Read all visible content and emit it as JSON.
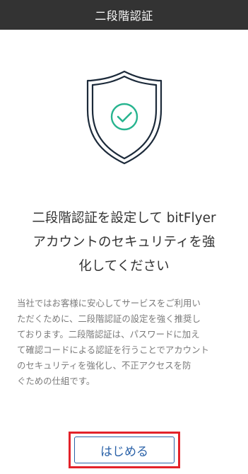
{
  "header": {
    "title": "二段階認証"
  },
  "hero": {
    "icon": "shield-check-icon",
    "colors": {
      "shield_stroke": "#1c2a3a",
      "check": "#27b48f"
    }
  },
  "headline": {
    "lines": [
      "二段階認証を設定して bitFlyer",
      "アカウントのセキュリティを強",
      "化してください"
    ]
  },
  "description": {
    "lines": [
      "当社ではお客様に安心してサービスをご利用い",
      "ただくために、二段階認証の設定を強く推奨し",
      "ております。二段階認証は、パスワードに加え",
      "て確認コードによる認証を行うことでアカウント",
      "のセキュリティを強化し、不正アクセスを防",
      "ぐための仕組です。"
    ]
  },
  "start_button": {
    "label": "はじめる",
    "color": "#2b62a8",
    "highlight_color": "#e3222a"
  }
}
